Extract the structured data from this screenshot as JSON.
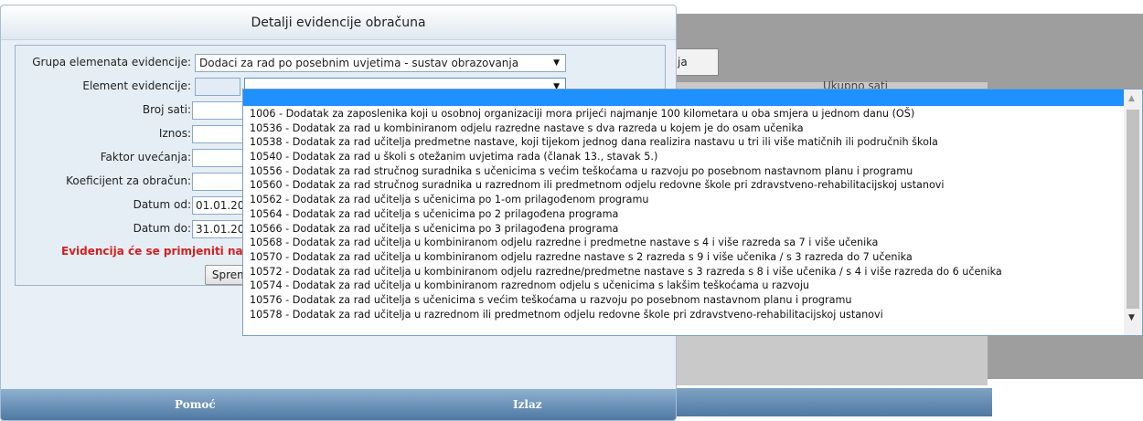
{
  "background": {
    "tab_button_label": "ja",
    "column_header": "Ukupno sati"
  },
  "dialog": {
    "title": "Detalji evidencije obračuna",
    "form": {
      "group_label": "Grupa elemenata evidencije:",
      "group_value": "Dodaci za rad po posebnim uvjetima - sustav obrazovanja",
      "element_label": "Element evidencije:",
      "element_value": "",
      "hours_label": "Broj sati:",
      "hours_value": "",
      "amount_label": "Iznos:",
      "amount_value": "",
      "factor_label": "Faktor uvećanja:",
      "factor_value": "",
      "coef_label": "Koeficijent za obračun:",
      "coef_value": "",
      "date_from_label": "Datum od:",
      "date_from_value": "01.01.20",
      "date_to_label": "Datum do:",
      "date_to_value": "31.01.20",
      "warning": "Evidencija će se primjeniti na",
      "save_label": "Spremi"
    },
    "footer": {
      "help_label": "Pomoć",
      "exit_label": "Izlaz"
    }
  },
  "dropdown": {
    "items": [
      "1006 - Dodatak za zaposlenika koji u osobnoj organizaciji mora prijeći najmanje 100 kilometara u oba smjera u jednom danu (OŠ)",
      "10536 - Dodatak za rad u kombiniranom odjelu razredne nastave s dva razreda u kojem je do osam učenika",
      "10538 - Dodatak za rad učitelja predmetne nastave, koji tijekom jednog dana realizira nastavu u tri ili više matičnih ili područnih škola",
      "10540 - Dodatak za rad u školi s otežanim uvjetima rada (članak 13., stavak 5.)",
      "10556 - Dodatak za rad stručnog suradnika s učenicima s većim teškoćama u razvoju po posebnom nastavnom planu i programu",
      "10560 - Dodatak za rad stručnog suradnika u razrednom ili predmetnom odjelu redovne škole pri zdravstveno-rehabilitacijskoj ustanovi",
      "10562 - Dodatak za rad učitelja s učenicima po 1-om prilagođenom programu",
      "10564 - Dodatak za rad učitelja s učenicima po 2 prilagođena programa",
      "10566 - Dodatak za rad učitelja s učenicima po 3 prilagođena programa",
      "10568 - Dodatak za rad učitelja u kombiniranom odjelu razredne i predmetne nastave s 4 i više razreda sa 7 i više učenika",
      "10570 - Dodatak za rad učitelja u kombiniranom odjelu razredne nastave s 2 razreda s 9 i više učenika / s 3 razreda do 7 učenika",
      "10572 - Dodatak za rad učitelja u kombiniranom odjelu razredne/predmetne nastave s 3 razreda s 8 i više učenika / s 4 i više razreda do 6 učenika",
      "10574 - Dodatak za rad učitelja u kombiniranom razrednom odjelu s učenicima s lakšim teškoćama u razvoju",
      "10576 - Dodatak za rad učitelja s učenicima s većim teškoćama u razvoju po posebnom nastavnom planu i programu",
      "10578 - Dodatak za rad učitelja u razrednom ili predmetnom odjelu redovne škole pri zdravstveno-rehabilitacijskoj ustanovi"
    ]
  }
}
